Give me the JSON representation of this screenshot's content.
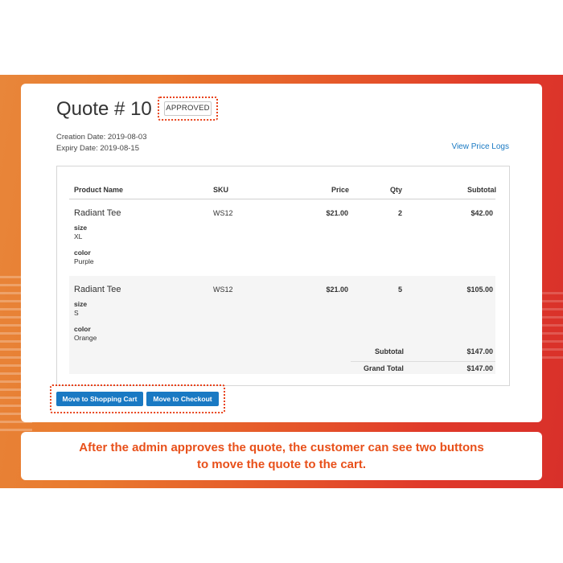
{
  "quote": {
    "title": "Quote # 10",
    "status": "APPROVED",
    "creation_date": "Creation Date: 2019-08-03",
    "expiry_date": "Expiry Date: 2019-08-15",
    "price_logs_link": "View Price Logs"
  },
  "table": {
    "headers": {
      "product": "Product Name",
      "sku": "SKU",
      "price": "Price",
      "qty": "Qty",
      "subtotal": "Subtotal"
    },
    "rows": [
      {
        "name": "Radiant Tee",
        "sku": "WS12",
        "price": "$21.00",
        "qty": "2",
        "subtotal": "$42.00",
        "options": [
          {
            "label": "size",
            "value": "XL"
          },
          {
            "label": "color",
            "value": "Purple"
          }
        ]
      },
      {
        "name": "Radiant Tee",
        "sku": "WS12",
        "price": "$21.00",
        "qty": "5",
        "subtotal": "$105.00",
        "options": [
          {
            "label": "size",
            "value": "S"
          },
          {
            "label": "color",
            "value": "Orange"
          }
        ]
      }
    ],
    "totals": {
      "subtotal_label": "Subtotal",
      "subtotal_value": "$147.00",
      "grand_total_label": "Grand Total",
      "grand_total_value": "$147.00"
    }
  },
  "actions": {
    "move_to_cart": "Move to Shopping Cart",
    "move_to_checkout": "Move to Checkout"
  },
  "caption": {
    "line1": "After the admin approves the quote, the customer can see two buttons",
    "line2": "to move the quote to the cart."
  },
  "colors": {
    "accent_link": "#1979c3",
    "highlight": "#e8421a",
    "caption_text": "#e8501a"
  }
}
